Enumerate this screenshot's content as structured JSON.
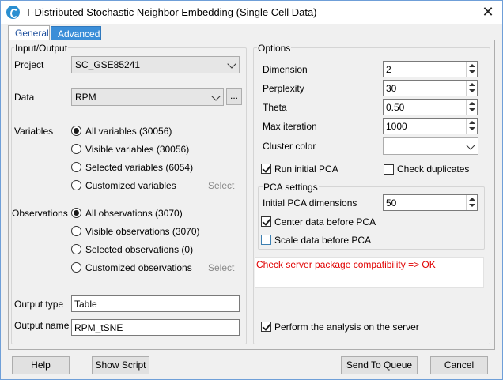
{
  "window": {
    "title": "T-Distributed Stochastic Neighbor Embedding (Single Cell Data)",
    "close_glyph": "✕"
  },
  "tabs": [
    {
      "label": "General"
    },
    {
      "label": "Advanced"
    }
  ],
  "input_output": {
    "title": "Input/Output",
    "project_label": "Project",
    "project_value": "SC_GSE85241",
    "data_label": "Data",
    "data_value": "RPM",
    "browse_label": "...",
    "variables_label": "Variables",
    "variables": [
      {
        "label": "All variables (30056)",
        "selected": true
      },
      {
        "label": "Visible variables (30056)",
        "selected": false
      },
      {
        "label": "Selected variables (6054)",
        "selected": false
      },
      {
        "label": "Customized variables",
        "selected": false
      }
    ],
    "variables_select": "Select",
    "observations_label": "Observations",
    "observations": [
      {
        "label": "All observations (3070)",
        "selected": true
      },
      {
        "label": "Visible observations (3070)",
        "selected": false
      },
      {
        "label": "Selected observations (0)",
        "selected": false
      },
      {
        "label": "Customized observations",
        "selected": false
      }
    ],
    "observations_select": "Select",
    "output_type_label": "Output type",
    "output_type_value": "Table",
    "output_name_label": "Output name",
    "output_name_value": "RPM_tSNE"
  },
  "options": {
    "title": "Options",
    "dimension_label": "Dimension",
    "dimension_value": "2",
    "perplexity_label": "Perplexity",
    "perplexity_value": "30",
    "theta_label": "Theta",
    "theta_value": "0.50",
    "max_iter_label": "Max iteration",
    "max_iter_value": "1000",
    "cluster_color_label": "Cluster color",
    "cluster_color_value": "",
    "run_pca_label": "Run initial PCA",
    "run_pca_checked": true,
    "check_dup_label": "Check duplicates",
    "check_dup_checked": false,
    "pca_settings_title": "PCA settings",
    "pca_dims_label": "Initial PCA dimensions",
    "pca_dims_value": "50",
    "center_label": "Center data before PCA",
    "center_checked": true,
    "scale_label": "Scale data before PCA",
    "scale_checked": false,
    "status_message": "Check server package compatibility => OK",
    "server_label": "Perform the analysis on the server",
    "server_checked": true
  },
  "buttons": {
    "help": "Help",
    "show_script": "Show Script",
    "send_to_queue": "Send To Queue",
    "cancel": "Cancel"
  },
  "colors": {
    "status_red": "#e00000",
    "tab_active_blue": "#3b8ed8",
    "window_border": "#6f9fd8"
  }
}
